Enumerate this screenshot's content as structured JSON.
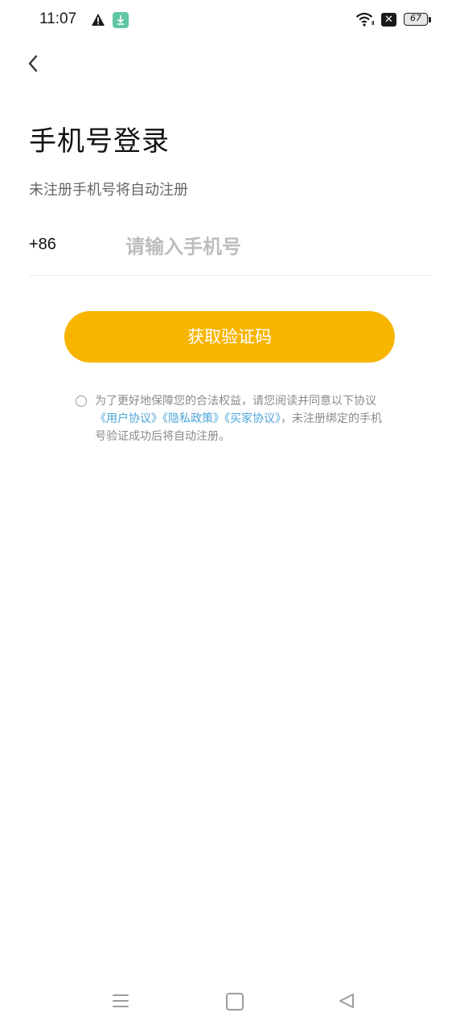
{
  "status_bar": {
    "time": "11:07",
    "battery": "67",
    "icons": [
      "warning-icon",
      "download-icon",
      "wifi-icon",
      "sim-disabled-icon",
      "battery-icon"
    ]
  },
  "header": {
    "back_icon": "chevron-left-icon"
  },
  "login": {
    "title": "手机号登录",
    "subtitle": "未注册手机号将自动注册",
    "country_code": "+86",
    "phone_placeholder": "请输入手机号",
    "phone_value": "",
    "submit_label": "获取验证码"
  },
  "agreement": {
    "prefix": "为了更好地保障您的合法权益，请您阅读并同意以下协议",
    "link_user": "《用户协议》",
    "link_privacy": "《隐私政策》",
    "link_buyer": "《买家协议》",
    "suffix": "，未注册绑定的手机号验证成功后将自动注册。",
    "checked": false
  },
  "nav_bar": {
    "icons": [
      "menu-icon",
      "home-icon",
      "back-triangle-icon"
    ]
  },
  "colors": {
    "accent": "#f7b500",
    "link": "#4ea6d8",
    "placeholder": "#bdbdbd",
    "subtitle": "#666666"
  }
}
